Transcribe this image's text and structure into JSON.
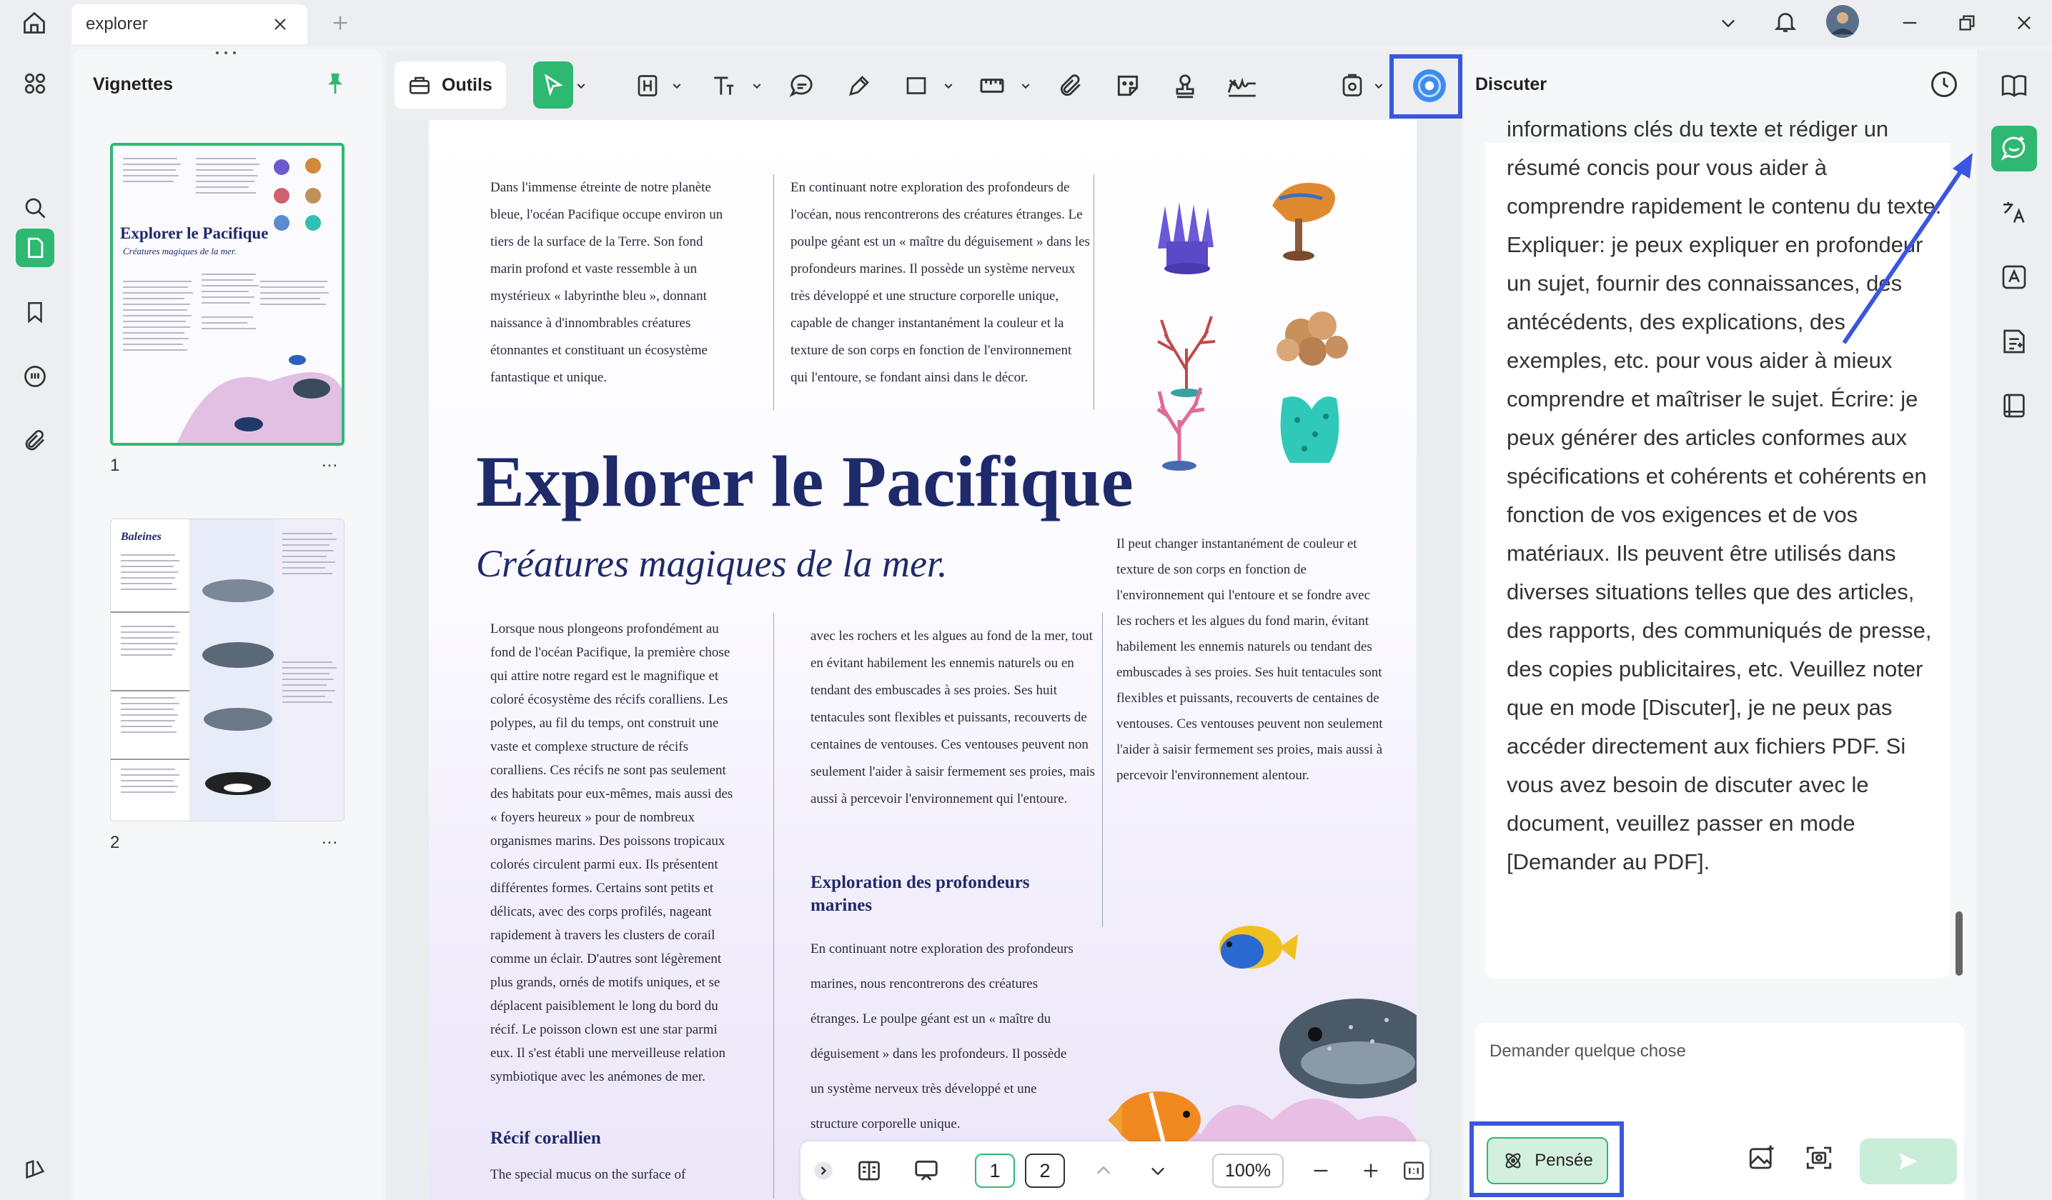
{
  "window": {
    "tab_label": "explorer"
  },
  "thumbnails": {
    "title": "Vignettes",
    "pages": [
      {
        "number": "1",
        "more": "..."
      },
      {
        "number": "2",
        "more": "..."
      }
    ]
  },
  "thumb1_text": {
    "title": "Explorer le Pacifique",
    "subtitle": "Créatures magiques de la mer."
  },
  "thumb2_text": {
    "title": "Baleines"
  },
  "toolbar": {
    "tools_label": "Outils"
  },
  "document": {
    "intro_left": "Dans l'immense étreinte de notre planète bleue, l'océan Pacifique occupe environ un tiers de la surface de la Terre. Son fond marin profond et vaste ressemble à un mystérieux « labyrinthe bleu », donnant naissance à d'innombrables créatures étonnantes et constituant un écosystème fantastique et unique.",
    "intro_right": "En continuant notre exploration des profondeurs de l'océan, nous rencontrerons des créatures étranges. Le poulpe géant est un « maître du déguisement » dans les profondeurs marines. Il possède un système nerveux très développé et une structure corporelle unique, capable de changer instantanément la couleur et la texture de son corps en fonction de l'environnement qui l'entoure, se fondant ainsi dans le décor.",
    "title": "Explorer le Pacifique",
    "subtitle": "Créatures magiques de la mer.",
    "side_paragraph": "Il peut changer instantanément de couleur et texture de son corps en fonction de l'environnement qui l'entoure et se fondre avec les rochers et les algues du fond marin, évitant habilement les ennemis naturels ou tendant des embuscades à ses proies. Ses huit tentacules sont flexibles et puissants, recouverts de centaines de ventouses. Ces ventouses peuvent non seulement l'aider à saisir fermement ses proies, mais aussi à percevoir l'environnement alentour.",
    "body_left": "Lorsque nous plongeons profondément au fond de l'océan Pacifique, la première chose qui attire notre regard est le magnifique et coloré écosystème des récifs coralliens. Les polypes, au fil du temps, ont construit une vaste et complexe structure de récifs coralliens. Ces récifs ne sont pas seulement des habitats pour eux-mêmes, mais aussi des « foyers heureux » pour de nombreux organismes marins. Des poissons tropicaux colorés circulent parmi eux. Ils présentent différentes formes. Certains sont petits et délicats, avec des corps profilés, nageant rapidement à travers les clusters de corail comme un éclair. D'autres sont légèrement plus grands, ornés de motifs uniques, et se déplacent paisiblement le long du bord du récif. Le poisson clown est une star parmi eux. Il s'est établi une merveilleuse relation symbiotique avec les anémones de mer.",
    "heading_recif": "Récif corallien",
    "recif_text": "The special mucus on the surface of",
    "body_middle": "avec les rochers et les algues au fond de la mer, tout en évitant habilement les ennemis naturels ou en tendant des embuscades à ses proies. Ses huit tentacules sont flexibles et puissants, recouverts de centaines de ventouses. Ces ventouses peuvent non seulement l'aider à saisir fermement ses proies, mais aussi à percevoir l'environnement qui l'entoure.",
    "heading_exploration": "Exploration des profondeurs marines",
    "exploration_text": "En continuant notre exploration des profondeurs marines, nous rencontrerons des créatures étranges. Le poulpe géant est un « maître du déguisement » dans les profondeurs. Il possède un système nerveux très développé et une structure corporelle unique."
  },
  "pagenav": {
    "page1": "1",
    "page2": "2",
    "zoom": "100%"
  },
  "chat": {
    "title": "Discuter",
    "message": "informations clés du texte et rédiger un résumé concis pour vous aider à comprendre rapidement le contenu du texte. Expliquer: je peux expliquer en profondeur un sujet, fournir des connaissances, des antécédents, des explications, des exemples, etc. pour vous aider à mieux comprendre et maîtriser le sujet. Écrire: je peux générer des articles conformes aux spécifications et cohérents et cohérents en fonction de vos exigences et de vos matériaux. Ils peuvent être utilisés dans diverses situations telles que des articles, des rapports, des communiqués de presse, des copies publicitaires, etc. Veuillez noter que en mode [Discuter], je ne peux pas accéder directement aux fichiers PDF. Si vous avez besoin de discuter avec le document, veuillez passer en mode [Demander au PDF].",
    "input_placeholder": "Demander quelque chose",
    "think_label": "Pensée"
  },
  "colors": {
    "accent_green": "#2fb872",
    "highlight_blue": "#3a56e0",
    "doc_title_navy": "#1f2a6b"
  },
  "icons": [
    "home-icon",
    "close-icon",
    "plus-icon",
    "chevron-down-icon",
    "bell-icon",
    "avatar",
    "minimize-icon",
    "restore-icon",
    "close-window-icon",
    "grid-icon",
    "search-icon",
    "page-icon",
    "bookmark-icon",
    "comment-icon",
    "attachment-icon",
    "layers-icon",
    "pin-icon",
    "toolbox-icon",
    "select-arrow-icon",
    "heading-icon",
    "text-icon",
    "comment-tool-icon",
    "pen-icon",
    "rectangle-icon",
    "ruler-icon",
    "paperclip-icon",
    "sticker-icon",
    "stamp-icon",
    "signature-icon",
    "ocr-icon",
    "ai-assistant-icon",
    "history-icon",
    "book-icon",
    "chat-ai-icon",
    "translate-icon",
    "grammar-icon",
    "summary-icon",
    "reader-icon",
    "image-icon",
    "screenshot-icon",
    "send-icon"
  ]
}
